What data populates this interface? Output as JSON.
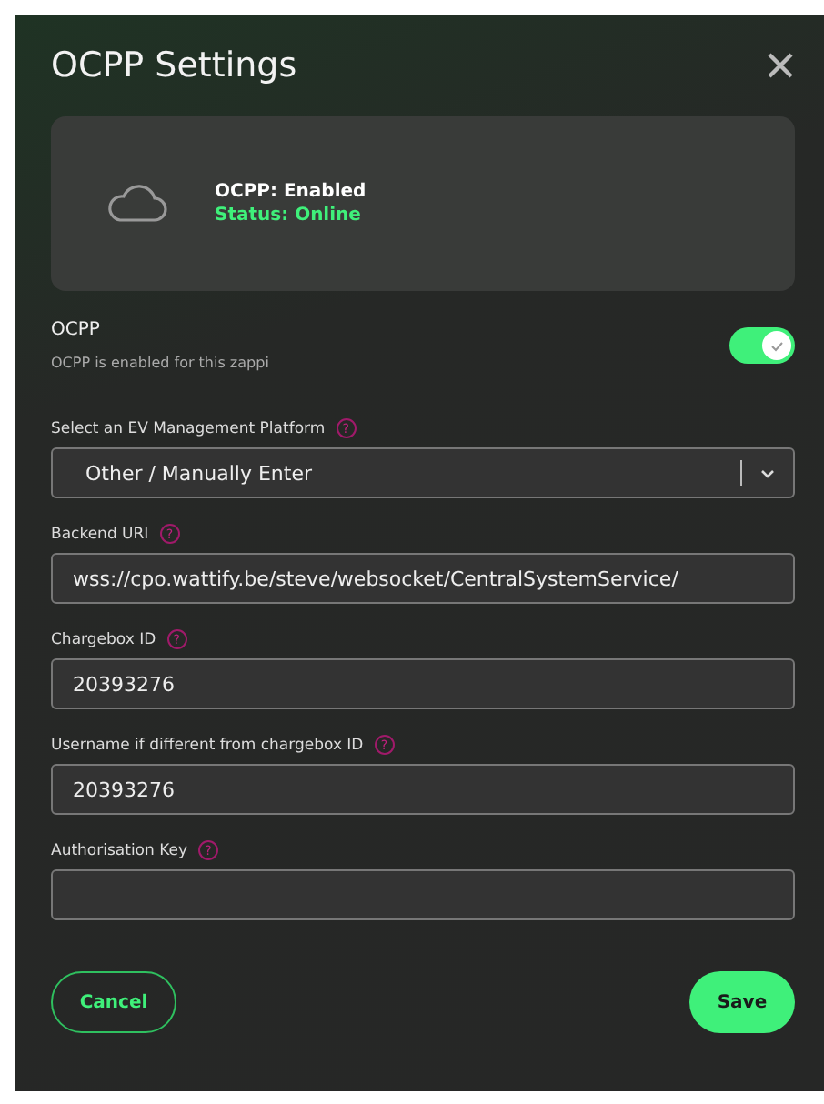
{
  "dialog": {
    "title": "OCPP Settings"
  },
  "status_card": {
    "title": "OCPP: Enabled",
    "status": "Status: Online"
  },
  "ocpp_toggle": {
    "label": "OCPP",
    "description": "OCPP is enabled for this zappi",
    "on": true
  },
  "fields": [
    {
      "kind": "select",
      "label": "Select an EV Management Platform",
      "value": "Other / Manually Enter"
    },
    {
      "kind": "text",
      "label": "Backend URI",
      "value": "wss://cpo.wattify.be/steve/websocket/CentralSystemService/"
    },
    {
      "kind": "text",
      "label": "Chargebox ID",
      "value": "20393276"
    },
    {
      "kind": "text",
      "label": "Username if different from chargebox ID",
      "value": "20393276"
    },
    {
      "kind": "text",
      "label": "Authorisation Key"
    }
  ],
  "buttons": {
    "cancel": "Cancel",
    "save": "Save"
  },
  "help_glyph": "?"
}
